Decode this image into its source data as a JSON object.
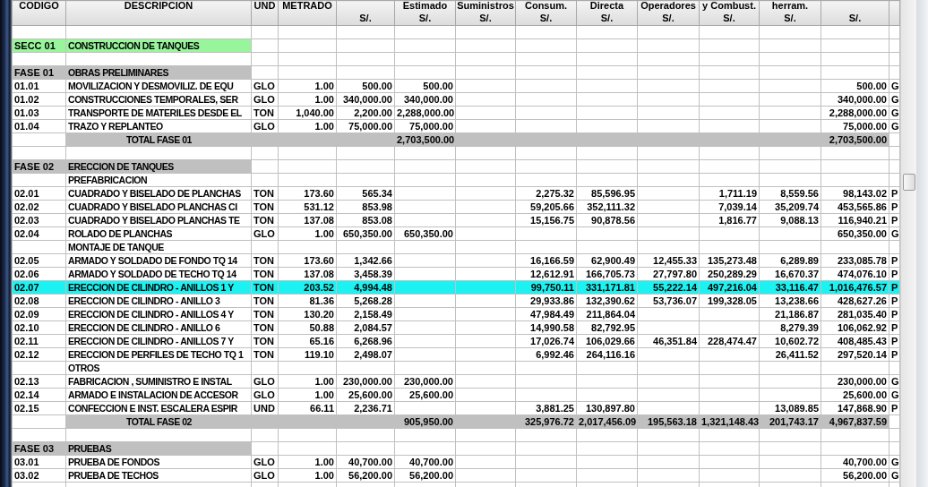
{
  "table": {
    "columns": [
      {
        "top": "CODIGO"
      },
      {
        "top": "DESCRIPCION"
      },
      {
        "top": "UND"
      },
      {
        "top": "METRADO"
      },
      {
        "bottom": "S/."
      },
      {
        "top": "Estimado",
        "bottom": "S/."
      },
      {
        "top": "Suministros",
        "bottom": "S/."
      },
      {
        "top": "Consum.",
        "bottom": "S/."
      },
      {
        "top": "Directa",
        "bottom": "S/."
      },
      {
        "top": "Operadores",
        "bottom": "S/."
      },
      {
        "top": "y Combust.",
        "bottom": "S/."
      },
      {
        "top": "herram.",
        "bottom": "S/."
      },
      {
        "bottom": "S/."
      },
      {}
    ],
    "rows": [
      {
        "kind": "blank",
        "selected": false
      },
      {
        "kind": "section",
        "selected": false,
        "cells": [
          "SECC 01",
          "CONSTRUCCION DE TANQUES",
          null,
          null,
          null,
          null,
          null,
          null,
          null,
          null,
          null,
          null,
          null,
          null
        ]
      },
      {
        "kind": "blank",
        "selected": false
      },
      {
        "kind": "phase",
        "selected": false,
        "cells": [
          "FASE 01",
          "OBRAS PRELIMINARES",
          null,
          null,
          null,
          null,
          null,
          null,
          null,
          null,
          null,
          null,
          null,
          null
        ]
      },
      {
        "kind": "item",
        "selected": false,
        "cells": [
          "01.01",
          "MOVILIZACION Y DESMOVILIZ. DE EQU",
          "GLO",
          "1.00",
          "500.00",
          "500.00",
          null,
          null,
          null,
          null,
          null,
          null,
          "500.00",
          "G"
        ]
      },
      {
        "kind": "item",
        "selected": false,
        "cells": [
          "01.02",
          "CONSTRUCCIONES TEMPORALES, SER",
          "GLO",
          "1.00",
          "340,000.00",
          "340,000.00",
          null,
          null,
          null,
          null,
          null,
          null,
          "340,000.00",
          "G"
        ]
      },
      {
        "kind": "item",
        "selected": false,
        "cells": [
          "01.03",
          "TRANSPORTE DE MATERILES DESDE EL",
          "TON",
          "1,040.00",
          "2,200.00",
          "2,288,000.00",
          null,
          null,
          null,
          null,
          null,
          null,
          "2,288,000.00",
          "G"
        ]
      },
      {
        "kind": "item",
        "selected": false,
        "cells": [
          "01.04",
          "TRAZO Y REPLANTEO",
          "GLO",
          "1.00",
          "75,000.00",
          "75,000.00",
          null,
          null,
          null,
          null,
          null,
          null,
          "75,000.00",
          "G"
        ]
      },
      {
        "kind": "total",
        "selected": false,
        "cells": [
          null,
          "TOTAL FASE 01",
          null,
          null,
          null,
          "2,703,500.00",
          null,
          null,
          null,
          null,
          null,
          null,
          "2,703,500.00",
          null
        ]
      },
      {
        "kind": "blank",
        "selected": false
      },
      {
        "kind": "phase",
        "selected": false,
        "cells": [
          "FASE 02",
          "ERECCION DE TANQUES",
          null,
          null,
          null,
          null,
          null,
          null,
          null,
          null,
          null,
          null,
          null,
          null
        ]
      },
      {
        "kind": "subheading",
        "selected": false,
        "cells": [
          null,
          "PREFABRICACION",
          null,
          null,
          null,
          null,
          null,
          null,
          null,
          null,
          null,
          null,
          null,
          null
        ]
      },
      {
        "kind": "item",
        "selected": false,
        "cells": [
          "02.01",
          "CUADRADO Y BISELADO DE PLANCHAS",
          "TON",
          "173.60",
          "565.34",
          null,
          null,
          "2,275.32",
          "85,596.95",
          null,
          "1,711.19",
          "8,559.56",
          "98,143.02",
          "P"
        ]
      },
      {
        "kind": "item",
        "selected": false,
        "cells": [
          "02.02",
          "CUADRADO Y BISELADO PLANCHAS CI",
          "TON",
          "531.12",
          "853.98",
          null,
          null,
          "59,205.66",
          "352,111.32",
          null,
          "7,039.14",
          "35,209.74",
          "453,565.86",
          "P"
        ]
      },
      {
        "kind": "item",
        "selected": false,
        "cells": [
          "02.03",
          "CUADRADO Y BISELADO PLANCHAS TE",
          "TON",
          "137.08",
          "853.08",
          null,
          null,
          "15,156.75",
          "90,878.56",
          null,
          "1,816.77",
          "9,088.13",
          "116,940.21",
          "P"
        ]
      },
      {
        "kind": "item",
        "selected": false,
        "cells": [
          "02.04",
          "ROLADO DE PLANCHAS",
          "GLO",
          "1.00",
          "650,350.00",
          "650,350.00",
          null,
          null,
          null,
          null,
          null,
          null,
          "650,350.00",
          "G"
        ]
      },
      {
        "kind": "subheading",
        "selected": false,
        "cells": [
          null,
          "MONTAJE DE TANQUE",
          null,
          null,
          null,
          null,
          null,
          null,
          null,
          null,
          null,
          null,
          null,
          null
        ]
      },
      {
        "kind": "item",
        "selected": false,
        "cells": [
          "02.05",
          "ARMADO Y SOLDADO DE FONDO TQ 14",
          "TON",
          "173.60",
          "1,342.66",
          null,
          null,
          "16,166.59",
          "62,900.49",
          "12,455.33",
          "135,273.48",
          "6,289.89",
          "233,085.78",
          "P"
        ]
      },
      {
        "kind": "item",
        "selected": false,
        "cells": [
          "02.06",
          "ARMADO Y SOLDADO DE TECHO TQ 14",
          "TON",
          "137.08",
          "3,458.39",
          null,
          null,
          "12,612.91",
          "166,705.73",
          "27,797.80",
          "250,289.29",
          "16,670.37",
          "474,076.10",
          "P"
        ]
      },
      {
        "kind": "item",
        "selected": true,
        "cells": [
          "02.07",
          "ERECCION DE CILINDRO - ANILLOS 1 Y",
          "TON",
          "203.52",
          "4,994.48",
          null,
          null,
          "99,750.11",
          "331,171.81",
          "55,222.14",
          "497,216.04",
          "33,116.47",
          "1,016,476.57",
          "P"
        ]
      },
      {
        "kind": "item",
        "selected": false,
        "cells": [
          "02.08",
          "ERECCION DE CILINDRO - ANILLO 3",
          "TON",
          "81.36",
          "5,268.28",
          null,
          null,
          "29,933.86",
          "132,390.62",
          "53,736.07",
          "199,328.05",
          "13,238.66",
          "428,627.26",
          "P"
        ]
      },
      {
        "kind": "item",
        "selected": false,
        "cells": [
          "02.09",
          "ERECCION DE CILINDRO - ANILLOS 4 Y",
          "TON",
          "130.20",
          "2,158.49",
          null,
          null,
          "47,984.49",
          "211,864.04",
          null,
          null,
          "21,186.87",
          "281,035.40",
          "P"
        ]
      },
      {
        "kind": "item",
        "selected": false,
        "cells": [
          "02.10",
          "ERECCION DE CILINDRO - ANILLO 6",
          "TON",
          "50.88",
          "2,084.57",
          null,
          null,
          "14,990.58",
          "82,792.95",
          null,
          null,
          "8,279.39",
          "106,062.92",
          "P"
        ]
      },
      {
        "kind": "item",
        "selected": false,
        "cells": [
          "02.11",
          "ERECCION DE CILINDRO - ANILLOS 7 Y",
          "TON",
          "65.16",
          "6,268.96",
          null,
          null,
          "17,026.74",
          "106,029.66",
          "46,351.84",
          "228,474.47",
          "10,602.72",
          "408,485.43",
          "P"
        ]
      },
      {
        "kind": "item",
        "selected": false,
        "cells": [
          "02.12",
          "ERECCION DE PERFILES DE TECHO TQ 1",
          "TON",
          "119.10",
          "2,498.07",
          null,
          null,
          "6,992.46",
          "264,116.16",
          null,
          null,
          "26,411.52",
          "297,520.14",
          "P"
        ]
      },
      {
        "kind": "subheading",
        "selected": false,
        "cells": [
          null,
          "OTROS",
          null,
          null,
          null,
          null,
          null,
          null,
          null,
          null,
          null,
          null,
          null,
          null
        ]
      },
      {
        "kind": "item",
        "selected": false,
        "cells": [
          "02.13",
          "FABRICACION , SUMINISTRO E INSTAL",
          "GLO",
          "1.00",
          "230,000.00",
          "230,000.00",
          null,
          null,
          null,
          null,
          null,
          null,
          "230,000.00",
          "G"
        ]
      },
      {
        "kind": "item",
        "selected": false,
        "cells": [
          "02.14",
          "ARMADO E INSTALACION DE ACCESOR",
          "GLO",
          "1.00",
          "25,600.00",
          "25,600.00",
          null,
          null,
          null,
          null,
          null,
          null,
          "25,600.00",
          "G"
        ]
      },
      {
        "kind": "item",
        "selected": false,
        "cells": [
          "02.15",
          "CONFECCION  E INST. ESCALERA ESPIR",
          "UND",
          "66.11",
          "2,236.71",
          null,
          null,
          "3,881.25",
          "130,897.80",
          null,
          null,
          "13,089.85",
          "147,868.90",
          "P"
        ]
      },
      {
        "kind": "total",
        "selected": false,
        "cells": [
          null,
          "TOTAL FASE 02",
          null,
          null,
          null,
          "905,950.00",
          null,
          "325,976.72",
          "2,017,456.09",
          "195,563.18",
          "1,321,148.43",
          "201,743.17",
          "4,967,837.59",
          null
        ]
      },
      {
        "kind": "blank",
        "selected": false
      },
      {
        "kind": "phase",
        "selected": false,
        "cells": [
          "FASE 03",
          "PRUEBAS",
          null,
          null,
          null,
          null,
          null,
          null,
          null,
          null,
          null,
          null,
          null,
          null
        ]
      },
      {
        "kind": "item",
        "selected": false,
        "cells": [
          "03.01",
          "PRUEBA DE FONDOS",
          "GLO",
          "1.00",
          "40,700.00",
          "40,700.00",
          null,
          null,
          null,
          null,
          null,
          null,
          "40,700.00",
          "G"
        ]
      },
      {
        "kind": "item",
        "selected": false,
        "cells": [
          "03.02",
          "PRUEBA DE TECHOS",
          "GLO",
          "1.00",
          "56,200.00",
          "56,200.00",
          null,
          null,
          null,
          null,
          null,
          null,
          "56,200.00",
          "G"
        ]
      }
    ]
  }
}
